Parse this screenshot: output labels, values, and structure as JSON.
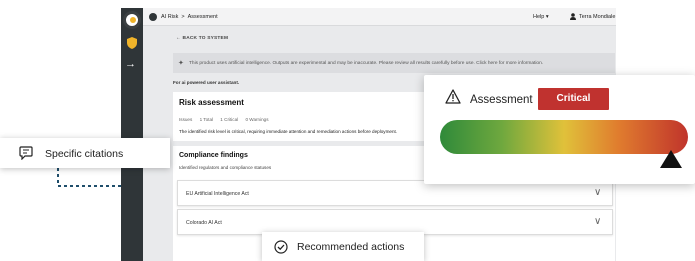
{
  "breadcrumb": {
    "root": "AI Risk",
    "separator": ">",
    "current": "Assessment"
  },
  "topbar": {
    "help": "Help",
    "help_chevron": "▾",
    "user": "Terra Mondiale"
  },
  "back_link": "← BACK TO SYSTEM",
  "banner": {
    "icon": "sparkle-icon",
    "text": "This product uses artificial intelligence. Outputs are experimental and may be inaccurate. Please review all results carefully before use. Click here for more information."
  },
  "ai_use_note": "For ai powered user assistant.",
  "risk_assessment": {
    "title": "Risk assessment",
    "stats": [
      "Issues",
      "1 Total",
      "1 Critical",
      "0 Warnings"
    ],
    "description": "The identified risk level is critical, requiring immediate attention and remediation actions before deployment."
  },
  "compliance": {
    "title": "Compliance findings",
    "subtitle": "Identified regulators and compliance statuses",
    "items": [
      {
        "label": "EU Artificial Intelligence Act"
      },
      {
        "label": "Colorado AI Act"
      }
    ],
    "chevron": "∨"
  },
  "assessment_card": {
    "label": "Assessment",
    "level": "Critical",
    "level_color": "#c0322f",
    "gauge_level": 0.95
  },
  "callouts": {
    "citations": "Specific citations",
    "recommended": "Recommended actions"
  },
  "colors": {
    "sidebar": "#2f3538",
    "accent_dots": "#1f4e6b"
  }
}
